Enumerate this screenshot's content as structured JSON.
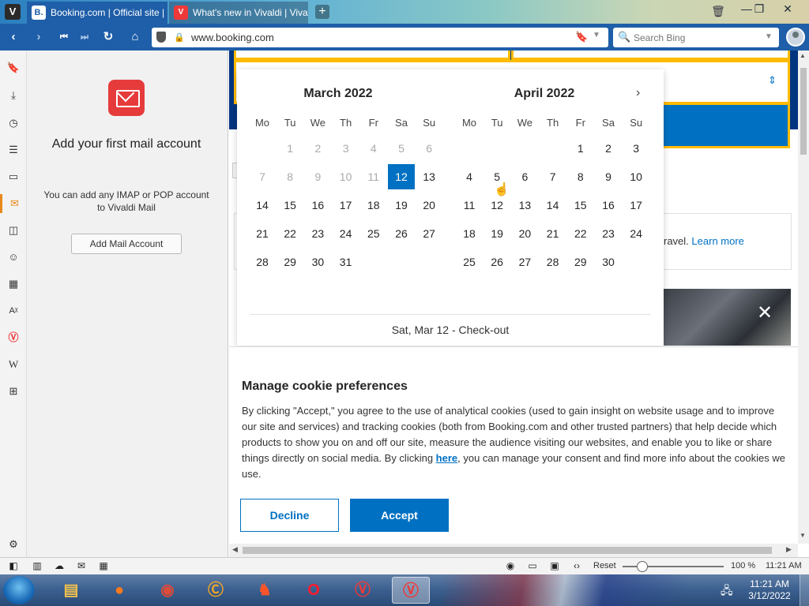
{
  "tabs": [
    {
      "label": "Booking.com | Official site |",
      "favicon": "B."
    },
    {
      "label": "What's new in Vivaldi | Viva",
      "favicon": "V"
    }
  ],
  "window_controls": {
    "minimize": "—",
    "restore": "❐",
    "close": "✕"
  },
  "address": {
    "url": "www.booking.com"
  },
  "search": {
    "placeholder": "Search Bing"
  },
  "mail_panel": {
    "title": "Add your first mail account",
    "description": "You can add any IMAP or POP account to Vivaldi Mail",
    "button": "Add Mail Account"
  },
  "calendar": {
    "months": [
      {
        "title": "March 2022"
      },
      {
        "title": "April 2022"
      }
    ],
    "weekdays": [
      "Mo",
      "Tu",
      "We",
      "Th",
      "Fr",
      "Sa",
      "Su"
    ],
    "footer": "Sat, Mar 12 - Check-out"
  },
  "booking": {
    "promo_text": "ravel.",
    "learn_more": "Learn more"
  },
  "cookie": {
    "title": "Manage cookie preferences",
    "text_before": "By clicking \"Accept,\" you agree to the use of analytical cookies (used to gain insight on website usage and to improve our site and services) and tracking cookies (both from Booking.com and other trusted partners) that help decide which products to show you on and off our site, measure the audience visiting our websites, and enable you to like or share things directly on social media. By clicking ",
    "link": "here",
    "text_after": ", you can manage your consent and find more info about the cookies we use.",
    "decline": "Decline",
    "accept": "Accept"
  },
  "statusbar": {
    "reset": "Reset",
    "zoom": "100 %",
    "time": "11:21 AM"
  },
  "taskbar": {
    "clock_time": "11:21 AM",
    "clock_date": "3/12/2022"
  },
  "colors": {
    "booking_blue": "#0071c2",
    "booking_navy": "#003580",
    "booking_yellow": "#febb02",
    "vivaldi_blue": "#1f5ea8",
    "mail_red": "#e63b3b"
  }
}
